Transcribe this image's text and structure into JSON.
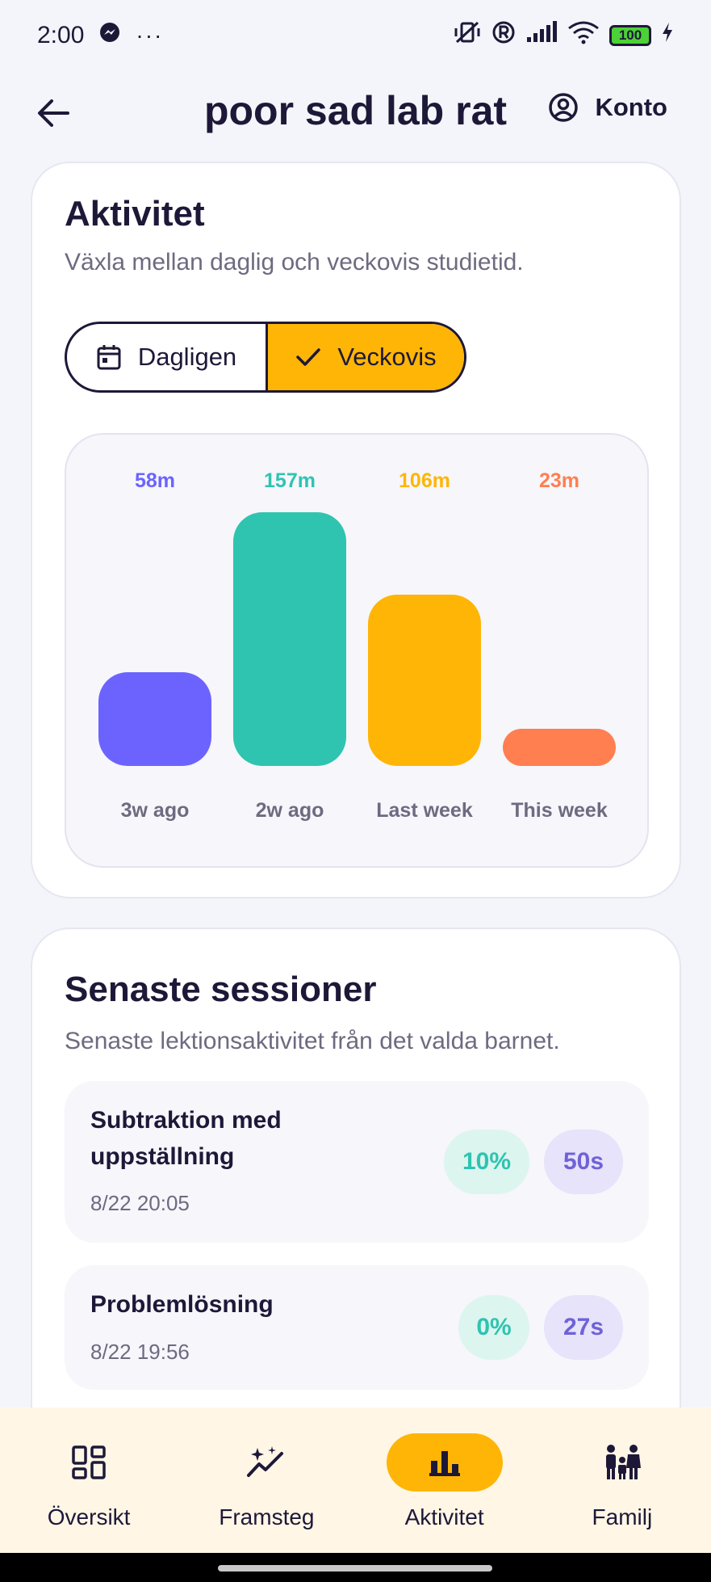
{
  "status_bar": {
    "time": "2:00",
    "more": "···",
    "battery": "100"
  },
  "header": {
    "title": "poor sad lab rat",
    "account_label": "Konto"
  },
  "activity": {
    "title": "Aktivitet",
    "subtitle": "Växla mellan daglig och veckovis studietid.",
    "toggle": {
      "daily": "Dagligen",
      "weekly": "Veckovis",
      "selected": "weekly"
    }
  },
  "chart_data": {
    "type": "bar",
    "categories": [
      "3w ago",
      "2w ago",
      "Last week",
      "This week"
    ],
    "values": [
      58,
      157,
      106,
      23
    ],
    "value_labels": [
      "58m",
      "157m",
      "106m",
      "23m"
    ],
    "colors": [
      "#6C63FF",
      "#2EC4B0",
      "#FFB505",
      "#FF7F50"
    ],
    "unit": "m",
    "title": "",
    "xlabel": "",
    "ylabel": "",
    "ylim": [
      0,
      157
    ],
    "grid": false
  },
  "sessions": {
    "title": "Senaste sessioner",
    "subtitle": "Senaste lektionsaktivitet från det valda barnet.",
    "items": [
      {
        "title_line1": "Subtraktion med",
        "title_line2": "uppställning",
        "time": "8/22 20:05",
        "score": "10%",
        "duration": "50s"
      },
      {
        "title_line1": "Problemlösning",
        "title_line2": "",
        "time": "8/22 19:56",
        "score": "0%",
        "duration": "27s"
      }
    ]
  },
  "nav": {
    "items": [
      {
        "label": "Översikt",
        "icon": "dashboard-icon"
      },
      {
        "label": "Framsteg",
        "icon": "progress-sparkle-icon"
      },
      {
        "label": "Aktivitet",
        "icon": "bar-chart-icon"
      },
      {
        "label": "Familj",
        "icon": "family-icon"
      }
    ],
    "active": 2
  },
  "colors": {
    "accent": "#FFB505",
    "text": "#1E1838",
    "muted": "#6E6A80",
    "nav_bg": "#FFF6E6"
  }
}
